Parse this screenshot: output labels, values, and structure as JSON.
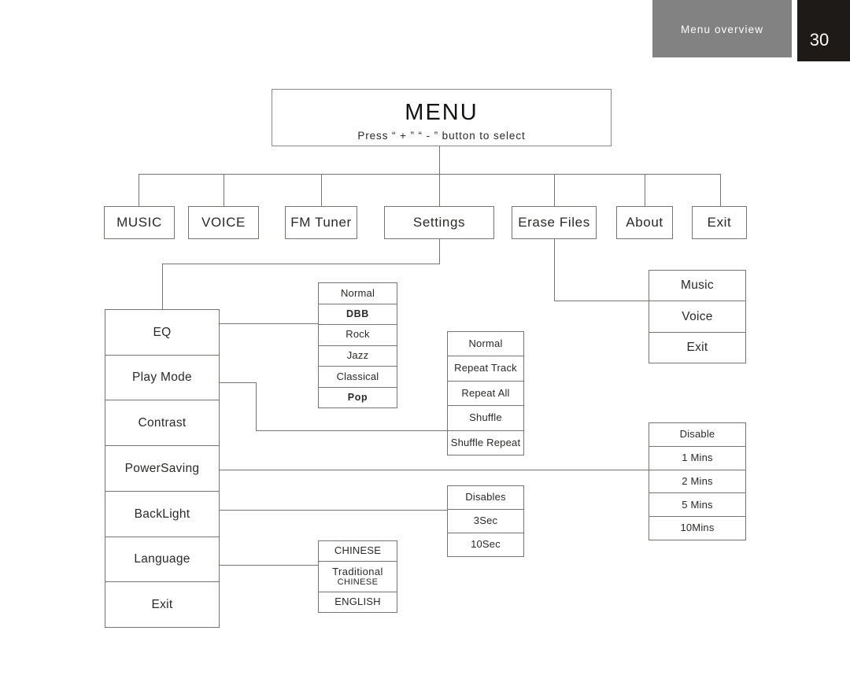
{
  "header": {
    "section_label": "Menu overview",
    "page_number": "30",
    "band_color": "#828282",
    "page_block_color": "#1d1a18"
  },
  "diagram": {
    "root": {
      "title": "MENU",
      "subtitle": "Press  “ + ”   “ - ”  button to select"
    },
    "level1": [
      {
        "label": "MUSIC"
      },
      {
        "label": "VOICE"
      },
      {
        "label": "FM Tuner"
      },
      {
        "label": "Settings"
      },
      {
        "label": "Erase Files"
      },
      {
        "label": "About"
      },
      {
        "label": "Exit"
      }
    ],
    "settings_menu": {
      "items": [
        {
          "label": "EQ"
        },
        {
          "label": "Play Mode"
        },
        {
          "label": "Contrast"
        },
        {
          "label": "PowerSaving"
        },
        {
          "label": "BackLight"
        },
        {
          "label": "Language"
        },
        {
          "label": "Exit"
        }
      ]
    },
    "eq_options": {
      "items": [
        {
          "label": "Normal",
          "bold": false
        },
        {
          "label": "DBB",
          "bold": true
        },
        {
          "label": "Rock",
          "bold": false
        },
        {
          "label": "Jazz",
          "bold": false
        },
        {
          "label": "Classical",
          "bold": false
        },
        {
          "label": "Pop",
          "bold": true
        }
      ]
    },
    "play_mode_options": {
      "items": [
        {
          "label": "Normal"
        },
        {
          "label": "Repeat Track"
        },
        {
          "label": "Repeat All"
        },
        {
          "label": "Shuffle"
        },
        {
          "label": "Shuffle Repeat"
        }
      ]
    },
    "power_saving_options": {
      "items": [
        {
          "label": "Disable"
        },
        {
          "label": "1 Mins"
        },
        {
          "label": "2 Mins"
        },
        {
          "label": "5 Mins"
        },
        {
          "label": "10Mins"
        }
      ]
    },
    "backlight_options": {
      "items": [
        {
          "label": "Disables"
        },
        {
          "label": "3Sec"
        },
        {
          "label": "10Sec"
        }
      ]
    },
    "language_options": {
      "items": [
        {
          "label": "CHINESE"
        },
        {
          "label": "Traditional",
          "label2": "CHINESE"
        },
        {
          "label": "ENGLISH"
        }
      ]
    },
    "erase_files_options": {
      "items": [
        {
          "label": "Music"
        },
        {
          "label": "Voice"
        },
        {
          "label": "Exit"
        }
      ]
    }
  }
}
